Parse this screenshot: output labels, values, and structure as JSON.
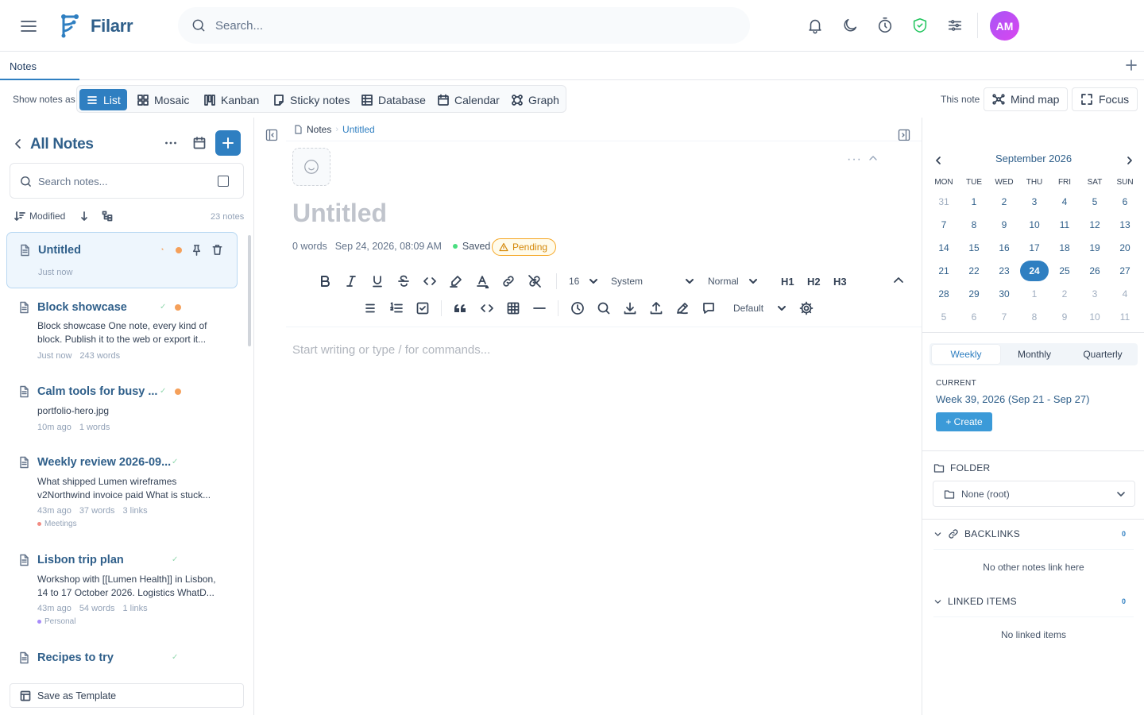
{
  "app": {
    "name": "Filarr",
    "avatar_initials": "AM",
    "accent": "#2f7fc1"
  },
  "search": {
    "placeholder": "Search..."
  },
  "tabs": [
    {
      "label": "Notes"
    }
  ],
  "viewbar": {
    "label": "Show notes as",
    "views": [
      "List",
      "Mosaic",
      "Kanban",
      "Sticky notes",
      "Database",
      "Calendar",
      "Graph"
    ],
    "active": "List",
    "this_note_label": "This note",
    "mind_map": "Mind map",
    "focus": "Focus"
  },
  "sidebar": {
    "title": "All Notes",
    "search_placeholder": "Search notes...",
    "sort_label": "Modified",
    "count_label": "23 notes",
    "save_template": "Save as Template",
    "notes": [
      {
        "title": "Untitled",
        "time": "Just now"
      },
      {
        "title": "Block showcase",
        "preview": "Block showcase One note, every kind of block. Publish it to the web or export it...",
        "time": "Just now",
        "words": "243 words"
      },
      {
        "title": "Calm tools for busy ...",
        "preview": "portfolio-hero.jpg",
        "time": "10m ago",
        "words": "1 words"
      },
      {
        "title": "Weekly review 2026-09...",
        "preview": "What shipped Lumen wireframes v2Northwind invoice paid What is stuck...",
        "time": "43m ago",
        "words": "37 words",
        "links": "3 links",
        "tag": "Meetings",
        "tag_color": "#f28b82"
      },
      {
        "title": "Lisbon trip plan",
        "preview": "Workshop with [[Lumen Health]] in Lisbon, 14 to 17 October 2026. Logistics WhatD...",
        "time": "43m ago",
        "words": "54 words",
        "links": "1 links",
        "tag": "Personal",
        "tag_color": "#a78bfa"
      },
      {
        "title": "Recipes to try"
      }
    ]
  },
  "editor": {
    "breadcrumb": [
      "Notes",
      "Untitled"
    ],
    "title": "Untitled",
    "word_count": "0 words",
    "datetime": "Sep 24, 2026, 08:09 AM",
    "saved": "Saved",
    "status": "Pending",
    "font_size": "16",
    "font_family": "System",
    "paragraph": "Normal",
    "headings": [
      "H1",
      "H2",
      "H3"
    ],
    "theme": "Default",
    "placeholder": "Start writing or type / for commands..."
  },
  "calendar": {
    "month": "September 2026",
    "weekdays": [
      "MON",
      "TUE",
      "WED",
      "THU",
      "FRI",
      "SAT",
      "SUN"
    ],
    "weeks": [
      [
        "31",
        "1",
        "2",
        "3",
        "4",
        "5",
        "6"
      ],
      [
        "7",
        "8",
        "9",
        "10",
        "11",
        "12",
        "13"
      ],
      [
        "14",
        "15",
        "16",
        "17",
        "18",
        "19",
        "20"
      ],
      [
        "21",
        "22",
        "23",
        "24",
        "25",
        "26",
        "27"
      ],
      [
        "28",
        "29",
        "30",
        "1",
        "2",
        "3",
        "4"
      ],
      [
        "5",
        "6",
        "7",
        "8",
        "9",
        "10",
        "11"
      ]
    ],
    "today": "24"
  },
  "period": {
    "tabs": [
      "Weekly",
      "Monthly",
      "Quarterly"
    ],
    "active": "Weekly",
    "current_label": "CURRENT",
    "week": "Week 39, 2026 (Sep 21 - Sep 27)",
    "create": "+ Create"
  },
  "folder": {
    "label": "FOLDER",
    "value": "None (root)"
  },
  "backlinks": {
    "label": "BACKLINKS",
    "count": "0",
    "empty": "No other notes link here"
  },
  "linked": {
    "label": "LINKED ITEMS",
    "count": "0",
    "empty": "No linked items"
  }
}
